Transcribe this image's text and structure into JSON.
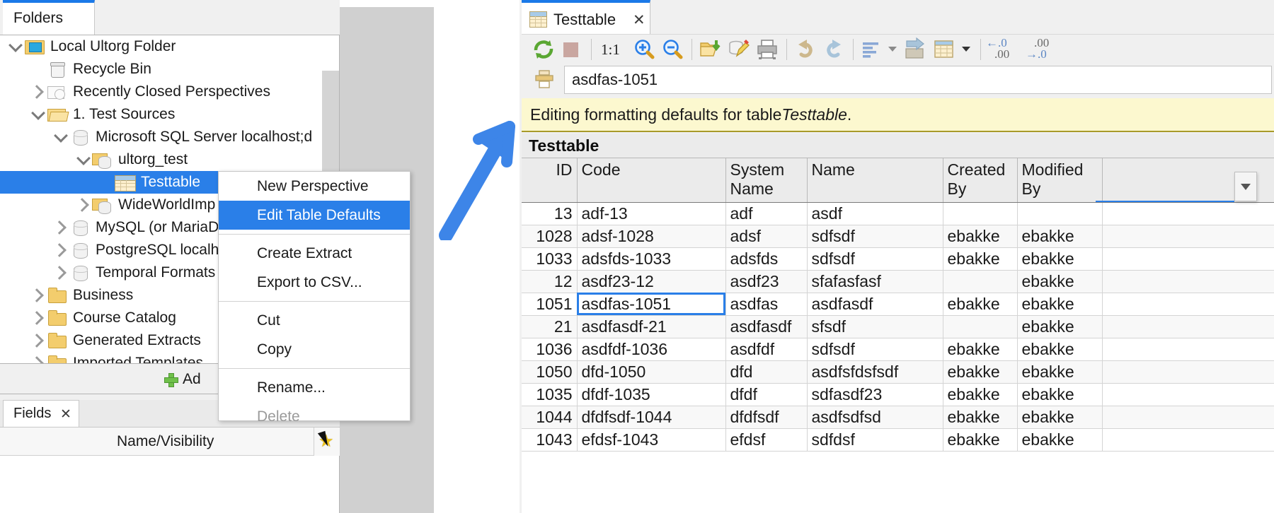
{
  "left_window": {
    "tab_label": "Folders",
    "minimize_icon": "minimize-icon",
    "tree": [
      {
        "label": "Local Ultorg Folder",
        "indent": 0,
        "twisty": "down",
        "icon": "computer-folder-icon",
        "selected": false
      },
      {
        "label": "Recycle Bin",
        "indent": 1,
        "twisty": "none",
        "icon": "recycle-bin-icon",
        "selected": false
      },
      {
        "label": "Recently Closed Perspectives",
        "indent": 1,
        "twisty": "right",
        "icon": "recent-folder-icon",
        "selected": false
      },
      {
        "label": "1. Test Sources",
        "indent": 1,
        "twisty": "down",
        "icon": "folder-open-icon",
        "selected": false
      },
      {
        "label": "Microsoft SQL Server localhost;d",
        "indent": 2,
        "twisty": "down",
        "icon": "database-icon",
        "selected": false
      },
      {
        "label": "ultorg_test",
        "indent": 3,
        "twisty": "down",
        "icon": "folder-database-icon",
        "selected": false
      },
      {
        "label": "Testtable",
        "indent": 4,
        "twisty": "none",
        "icon": "table-icon",
        "selected": true
      },
      {
        "label": "WideWorldImp",
        "indent": 3,
        "twisty": "right",
        "icon": "folder-database-icon",
        "selected": false
      },
      {
        "label": "MySQL (or MariaD",
        "indent": 2,
        "twisty": "right",
        "icon": "database-icon",
        "selected": false
      },
      {
        "label": "PostgreSQL localh",
        "indent": 2,
        "twisty": "right",
        "icon": "database-icon",
        "selected": false
      },
      {
        "label": "Temporal Formats",
        "indent": 2,
        "twisty": "right",
        "icon": "database-icon",
        "selected": false
      },
      {
        "label": "Business",
        "indent": 1,
        "twisty": "right",
        "icon": "folder-icon",
        "selected": false
      },
      {
        "label": "Course Catalog",
        "indent": 1,
        "twisty": "right",
        "icon": "folder-icon",
        "selected": false
      },
      {
        "label": "Generated Extracts",
        "indent": 1,
        "twisty": "right",
        "icon": "folder-icon",
        "selected": false
      },
      {
        "label": "Imported Templates",
        "indent": 1,
        "twisty": "right",
        "icon": "folder-icon",
        "selected": false
      }
    ],
    "add_button_label": "Ad",
    "fields_tab_label": "Fields",
    "fields_tab_close_icon": "close-icon",
    "fields_column_header": "Name/Visibility",
    "fields_star_icon": "star-icon"
  },
  "context_menu": {
    "items": [
      {
        "label": "New Perspective",
        "state": "normal"
      },
      {
        "label": "Edit Table Defaults",
        "state": "highlighted"
      },
      {
        "sep": true
      },
      {
        "label": "Create Extract",
        "state": "normal"
      },
      {
        "label": "Export to CSV...",
        "state": "normal"
      },
      {
        "sep": true
      },
      {
        "label": "Cut",
        "state": "normal"
      },
      {
        "label": "Copy",
        "state": "normal"
      },
      {
        "sep": true
      },
      {
        "label": "Rename...",
        "state": "normal"
      },
      {
        "label": "Delete",
        "state": "disabled"
      }
    ]
  },
  "annotation": {
    "arrow_icon": "blue-arrow-annotation",
    "arrow_color": "#3d85e8"
  },
  "right_window": {
    "tab_label": "Testtable",
    "tab_icon": "table-icon",
    "tab_close_icon": "close-icon",
    "toolbar": [
      {
        "name": "refresh-icon",
        "label": ""
      },
      {
        "name": "stop-icon",
        "label": ""
      },
      {
        "sep": true
      },
      {
        "name": "zoom-reset-label",
        "label": "1:1"
      },
      {
        "name": "zoom-in-icon",
        "label": ""
      },
      {
        "name": "zoom-out-icon",
        "label": ""
      },
      {
        "sep": true
      },
      {
        "name": "open-folder-icon",
        "label": ""
      },
      {
        "name": "edit-database-icon",
        "label": ""
      },
      {
        "name": "print-icon",
        "label": ""
      },
      {
        "sep": true
      },
      {
        "name": "undo-icon",
        "label": ""
      },
      {
        "name": "redo-icon",
        "label": ""
      },
      {
        "sep": true
      },
      {
        "name": "align-left-icon",
        "label": ""
      },
      {
        "name": "align-dropdown-caret-icon",
        "label": ""
      },
      {
        "name": "export-table-icon",
        "label": ""
      },
      {
        "name": "table-format-icon",
        "label": ""
      },
      {
        "name": "table-format-caret-icon",
        "label": ""
      },
      {
        "sep": true
      },
      {
        "name": "decrease-decimal-icon",
        "label": ""
      },
      {
        "name": "increase-decimal-icon",
        "label": ""
      }
    ],
    "zoom_label": "1:1",
    "decimal_left_top": "←.0",
    "decimal_left_bottom": ".00",
    "decimal_right_top": ".00",
    "decimal_right_bottom": "→.0",
    "print_row_icon": "print-row-icon",
    "address_value": "asdfas-1051",
    "notice_prefix": "Editing formatting defaults for table ",
    "notice_table": "Testtable",
    "notice_suffix": ".",
    "grid_title": "Testtable",
    "column_dropdown_icon": "column-dropdown-icon",
    "columns": [
      "ID",
      "Code",
      "System Name",
      "Name",
      "Created By",
      "Modified By"
    ],
    "rows": [
      {
        "ID": "13",
        "Code": "adf-13",
        "System Name": "adf",
        "Name": "asdf",
        "Created By": "",
        "Modified By": ""
      },
      {
        "ID": "1028",
        "Code": "adsf-1028",
        "System Name": "adsf",
        "Name": "sdfsdf",
        "Created By": "ebakke",
        "Modified By": "ebakke"
      },
      {
        "ID": "1033",
        "Code": "adsfds-1033",
        "System Name": "adsfds",
        "Name": "sdfsdf",
        "Created By": "ebakke",
        "Modified By": "ebakke"
      },
      {
        "ID": "12",
        "Code": "asdf23-12",
        "System Name": "asdf23",
        "Name": "sfafasfasf",
        "Created By": "",
        "Modified By": "ebakke"
      },
      {
        "ID": "1051",
        "Code": "asdfas-1051",
        "System Name": "asdfas",
        "Name": "asdfasdf",
        "Created By": "ebakke",
        "Modified By": "ebakke"
      },
      {
        "ID": "21",
        "Code": "asdfasdf-21",
        "System Name": "asdfasdf",
        "Name": "sfsdf",
        "Created By": "",
        "Modified By": "ebakke"
      },
      {
        "ID": "1036",
        "Code": "asdfdf-1036",
        "System Name": "asdfdf",
        "Name": "sdfsdf",
        "Created By": "ebakke",
        "Modified By": "ebakke"
      },
      {
        "ID": "1050",
        "Code": "dfd-1050",
        "System Name": "dfd",
        "Name": "asdfsfdsfsdf",
        "Created By": "ebakke",
        "Modified By": "ebakke"
      },
      {
        "ID": "1035",
        "Code": "dfdf-1035",
        "System Name": "dfdf",
        "Name": "sdfasdf23",
        "Created By": "ebakke",
        "Modified By": "ebakke"
      },
      {
        "ID": "1044",
        "Code": "dfdfsdf-1044",
        "System Name": "dfdfsdf",
        "Name": "asdfsdfsd",
        "Created By": "ebakke",
        "Modified By": "ebakke"
      },
      {
        "ID": "1043",
        "Code": "efdsf-1043",
        "System Name": "efdsf",
        "Name": "sdfdsf",
        "Created By": "ebakke",
        "Modified By": "ebakke"
      }
    ],
    "selected_cell": {
      "row": 4,
      "column": "Code"
    }
  },
  "colors": {
    "accent": "#2a7fe8",
    "notice_bg": "#fcf8cf",
    "notice_border": "#a89a2a",
    "header_bg": "#ebebeb"
  }
}
